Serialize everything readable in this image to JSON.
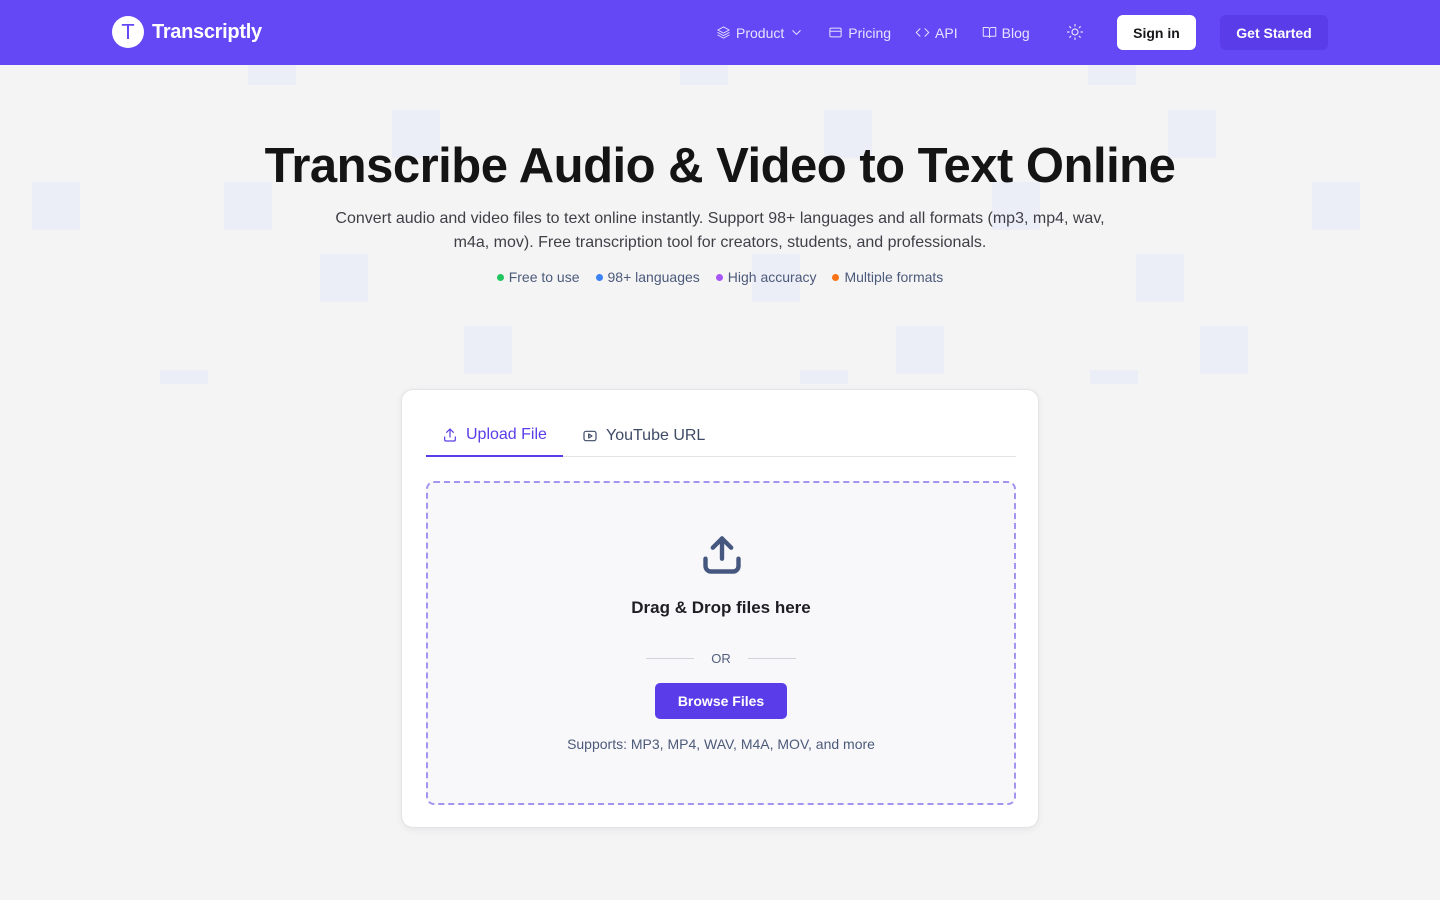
{
  "header": {
    "brand_initial": "T",
    "brand_name": "Transcriptly",
    "nav": {
      "product": "Product",
      "pricing": "Pricing",
      "api": "API",
      "blog": "Blog"
    },
    "sign_in": "Sign in",
    "get_started": "Get Started",
    "accent_color": "#6447f5"
  },
  "hero": {
    "title": "Transcribe Audio & Video to Text Online",
    "subtitle": "Convert audio and video files to text online instantly. Support 98+ languages and all formats (mp3, mp4, wav, m4a, mov). Free transcription tool for creators, students, and professionals.",
    "features": [
      {
        "label": "Free to use",
        "color": "#22c55e"
      },
      {
        "label": "98+ languages",
        "color": "#3b82f6"
      },
      {
        "label": "High accuracy",
        "color": "#a855f7"
      },
      {
        "label": "Multiple formats",
        "color": "#f97316"
      }
    ]
  },
  "uploader": {
    "tabs": {
      "upload": "Upload File",
      "youtube": "YouTube URL"
    },
    "active_tab": "Upload File",
    "drop_title": "Drag & Drop files here",
    "or_text": "OR",
    "browse_label": "Browse Files",
    "supports_text": "Supports: MP3, MP4, WAV, M4A, MOV, and more"
  }
}
